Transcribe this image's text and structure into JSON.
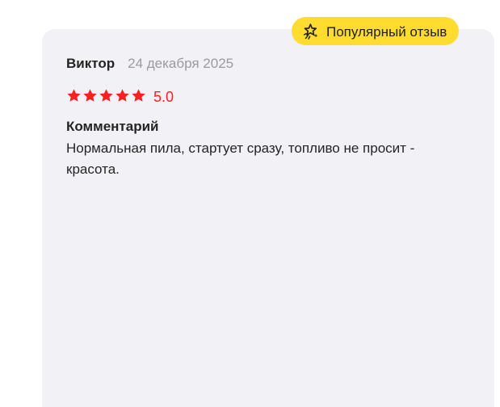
{
  "badge": {
    "label": "Популярный отзыв",
    "icon": "sparkle-star-icon"
  },
  "review": {
    "author": "Виктор",
    "date": "24 декабря 2025",
    "rating_value": "5.0",
    "stars": 5,
    "comment_title": "Комментарий",
    "comment_text": "Нормальная пила, стартует сразу, топливо не просит - красота."
  },
  "colors": {
    "card_background": "#f2f1f6",
    "badge_background": "#ffdc2f",
    "rating_red": "#ff1f1f",
    "date_gray": "#9a9aa1",
    "text_dark": "#242424"
  }
}
